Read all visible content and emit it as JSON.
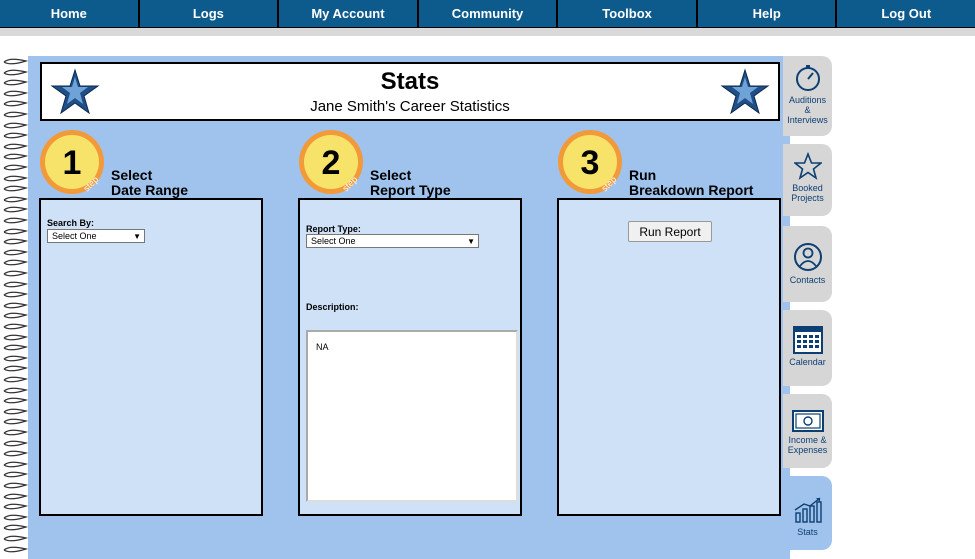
{
  "nav": {
    "items": [
      "Home",
      "Logs",
      "My Account",
      "Community",
      "Toolbox",
      "Help",
      "Log Out"
    ]
  },
  "header": {
    "title": "Stats",
    "subtitle": "Jane Smith's Career Statistics"
  },
  "steps": [
    {
      "number": "1",
      "badge_word": "step",
      "title_line1": "Select",
      "title_line2": "Date Range"
    },
    {
      "number": "2",
      "badge_word": "step",
      "title_line1": "Select",
      "title_line2": "Report Type"
    },
    {
      "number": "3",
      "badge_word": "step",
      "title_line1": "Run",
      "title_line2": "Breakdown Report"
    }
  ],
  "panel1": {
    "search_by_label": "Search By:",
    "search_by_value": "Select One"
  },
  "panel2": {
    "report_type_label": "Report Type:",
    "report_type_value": "Select One",
    "description_label": "Description:",
    "description_value": "NA"
  },
  "panel3": {
    "run_button": "Run Report"
  },
  "tabs": [
    {
      "label_lines": [
        "Auditions",
        "&",
        "Interviews"
      ],
      "icon": "stopwatch-icon"
    },
    {
      "label_lines": [
        "Booked",
        "Projects"
      ],
      "icon": "star-icon"
    },
    {
      "label_lines": [
        "Contacts"
      ],
      "icon": "person-icon"
    },
    {
      "label_lines": [
        "Calendar"
      ],
      "icon": "calendar-icon"
    },
    {
      "label_lines": [
        "Income &",
        "Expenses"
      ],
      "icon": "money-icon"
    },
    {
      "label_lines": [
        "Stats"
      ],
      "icon": "bar-chart-icon"
    }
  ],
  "colors": {
    "nav_bg": "#0d5a8c",
    "notebook_bg": "#9fc3ec",
    "panel_bg": "#cfe1f7",
    "tab_bg": "#d6d6d6",
    "badge_yellow": "#f7e36a",
    "badge_orange": "#f29a3a",
    "icon_blue": "#0d3f73"
  }
}
